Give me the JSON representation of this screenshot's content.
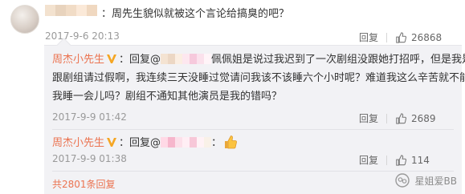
{
  "top_comment": {
    "mention_prefix": "：",
    "text": "周先生貌似就被这个言论给搞臭的吧？",
    "time": "2017-9-6 20:13",
    "reply_label": "回复",
    "like_count": "26868"
  },
  "reply_1": {
    "user": "周杰小先生",
    "colon": "：",
    "reply_prefix": "回复@",
    "mention_tail": "佩佩姐是说过我迟到了一次剧组没跟她打招呼，但是我是",
    "line2": "跟剧组请过假啊，我连续三天没睡过觉请问我该不该睡六个小时呢？难道我这么辛苦就不能让",
    "line3": "我睡一会儿吗？剧组不通知其他演员是我的错吗？",
    "time": "2017-9-9 01:42",
    "reply_label": "回复",
    "like_count": "2689"
  },
  "reply_2": {
    "user": "周杰小先生",
    "colon": "：",
    "reply_prefix": "回复@",
    "mention_tail": "：",
    "time": "2017-9-9 01:38",
    "reply_label": "回复",
    "like_count": "114"
  },
  "footer": {
    "more_replies": "共2801条回复"
  },
  "watermark": {
    "text": "星姐爱BB"
  },
  "colors": {
    "accent": "#eb7350",
    "badge": "#f5a623",
    "reply_bg": "#f2f2f5"
  }
}
